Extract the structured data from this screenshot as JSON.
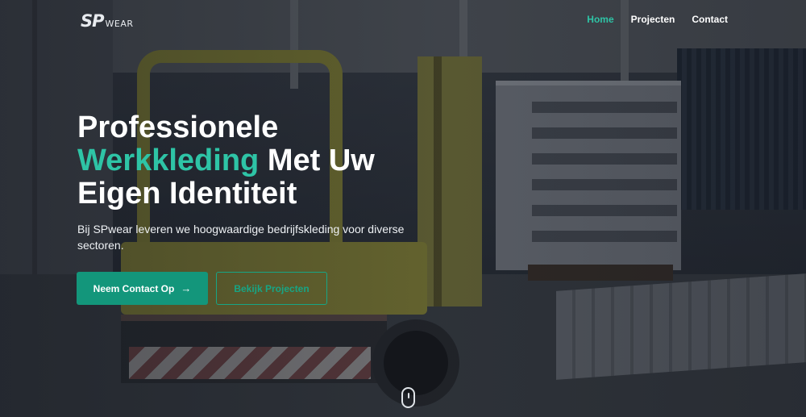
{
  "brand": {
    "logo_primary": "SP",
    "logo_secondary": "WEAR"
  },
  "nav": {
    "items": [
      {
        "label": "Home",
        "active": true
      },
      {
        "label": "Projecten",
        "active": false
      },
      {
        "label": "Contact",
        "active": false
      }
    ]
  },
  "hero": {
    "headline_line1": "Professionele",
    "headline_accent": "Werkkleding",
    "headline_line2_rest": " Met Uw",
    "headline_line3": "Eigen Identiteit",
    "subtext": "Bij SPwear leveren we hoogwaardige bedrijfskleding voor diverse sectoren.",
    "primary_button": "Neem Contact Op",
    "secondary_button": "Bekijk Projecten"
  },
  "colors": {
    "accent": "#2ec4a6",
    "button_primary": "#13967b"
  },
  "icons": {
    "primary_button_icon": "arrow-right-icon",
    "scroll_indicator": "mouse-scroll-icon"
  }
}
